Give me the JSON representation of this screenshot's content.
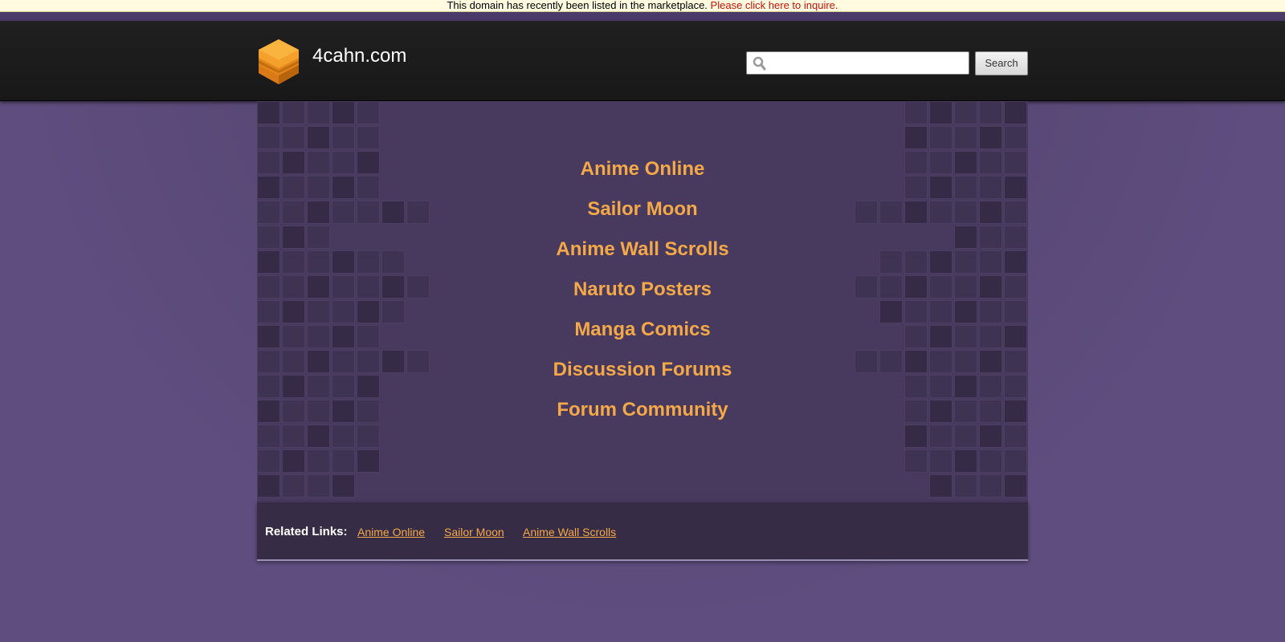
{
  "notice": {
    "text": "This domain has recently been listed in the marketplace.",
    "link": "Please click here to inquire."
  },
  "header": {
    "site_title": "4cahn.com",
    "logo_icon": "cube-stack-icon",
    "search": {
      "value": "",
      "placeholder": "",
      "button_label": "Search"
    }
  },
  "main": {
    "links": [
      "Anime Online",
      "Sailor Moon",
      "Anime Wall Scrolls",
      "Naruto Posters",
      "Manga Comics",
      "Discussion Forums",
      "Forum Community"
    ]
  },
  "footer": {
    "related_label": "Related Links:",
    "related_links": [
      "Anime Online",
      "Sailor Moon",
      "Anime Wall Scrolls"
    ]
  },
  "colors": {
    "link": "#f5a848",
    "notice_link": "#c4130a",
    "header_bg": "#1c1c1c",
    "panel_bg": "#473a5e",
    "page_bg": "#5e4d7e"
  }
}
